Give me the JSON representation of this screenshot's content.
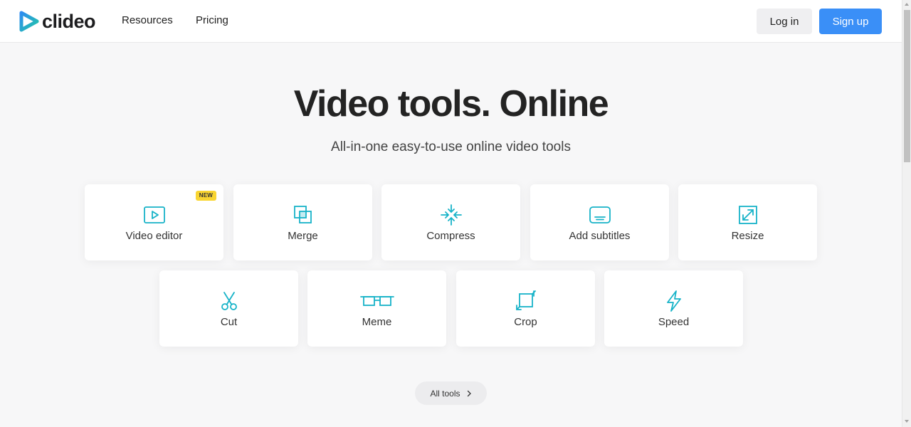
{
  "header": {
    "brand": "clideo",
    "nav": [
      {
        "label": "Resources"
      },
      {
        "label": "Pricing"
      }
    ],
    "login_label": "Log in",
    "signup_label": "Sign up"
  },
  "hero": {
    "title": "Video tools. Online",
    "subtitle": "All-in-one easy-to-use online video tools"
  },
  "tools": [
    {
      "label": "Video editor",
      "icon": "play-icon",
      "badge": "NEW"
    },
    {
      "label": "Merge",
      "icon": "merge-icon"
    },
    {
      "label": "Compress",
      "icon": "compress-icon"
    },
    {
      "label": "Add subtitles",
      "icon": "subtitles-icon"
    },
    {
      "label": "Resize",
      "icon": "resize-icon"
    },
    {
      "label": "Cut",
      "icon": "scissors-icon"
    },
    {
      "label": "Meme",
      "icon": "meme-icon"
    },
    {
      "label": "Crop",
      "icon": "crop-icon"
    },
    {
      "label": "Speed",
      "icon": "lightning-icon"
    }
  ],
  "all_tools_label": "All tools",
  "colors": {
    "accent": "#3a8ff7",
    "icon_teal": "#17b3c8",
    "badge": "#f9d531"
  }
}
